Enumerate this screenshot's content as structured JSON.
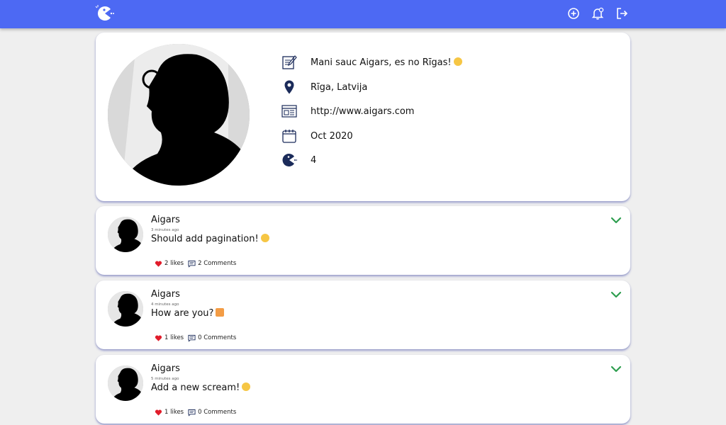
{
  "navbar": {
    "logo_icon": "pacman-logo-icon",
    "add_icon": "add-circle-icon",
    "notifications_icon": "notification-bell-icon",
    "logout_icon": "logout-icon",
    "color": "#4d69f3"
  },
  "profile": {
    "bio": "Mani sauc Aigars, es no Rīgas!",
    "location": "Rīga, Latvija",
    "website": "http://www.aigars.com",
    "joined": "Oct 2020",
    "screams_count": "4"
  },
  "screams": [
    {
      "user": "Aigars",
      "time": "3 minutes ago",
      "body": "Should add pagination!",
      "likes": "2 likes",
      "comments": "2 Comments"
    },
    {
      "user": "Aigars",
      "time": "4 minutes ago",
      "body": "How are you?",
      "likes": "1 likes",
      "comments": "0 Comments"
    },
    {
      "user": "Aigars",
      "time": "5 minutes ago",
      "body": "Add a new scream!",
      "likes": "1 likes",
      "comments": "0 Comments"
    }
  ],
  "colors": {
    "like": "#e11d2b",
    "expand": "#2e9e4f",
    "icon": "#1b2b5a"
  }
}
